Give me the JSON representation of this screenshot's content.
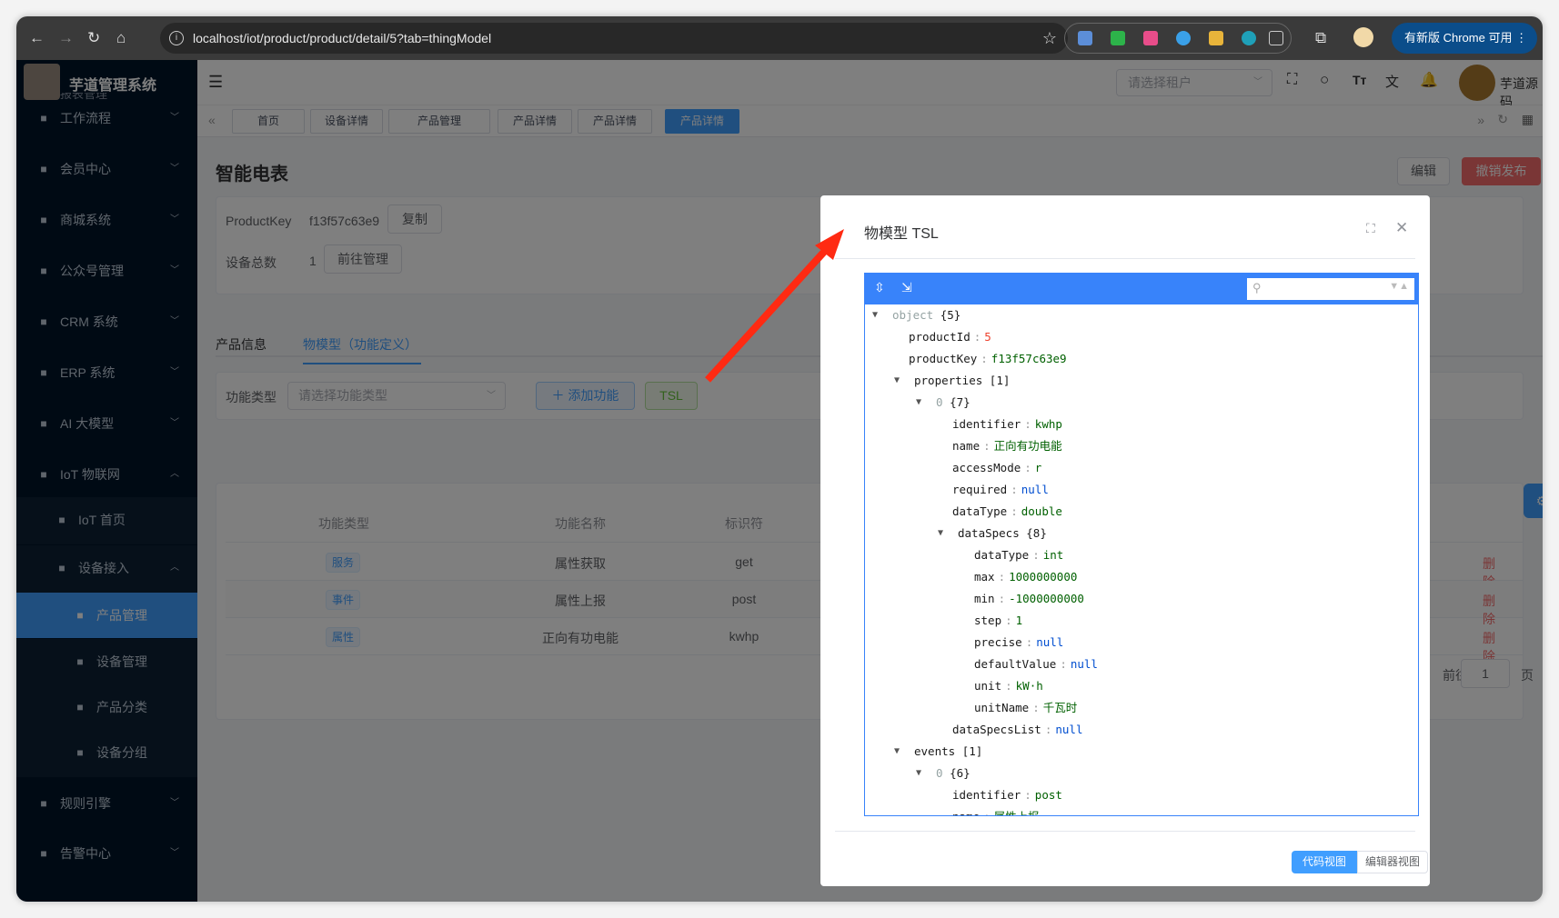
{
  "browser": {
    "url": "localhost/iot/product/product/detail/5?tab=thingModel",
    "update_label": "有新版 Chrome 可用"
  },
  "app": {
    "title": "芋道管理系统",
    "tenant_placeholder": "请选择租户",
    "username": "芋道源码"
  },
  "sidebar": {
    "partial_label": "报表管理",
    "items": [
      {
        "label": "工作流程",
        "icon": "workflow-icon",
        "chev": "﹀",
        "level": 0
      },
      {
        "label": "会员中心",
        "icon": "member-icon",
        "chev": "﹀",
        "level": 0
      },
      {
        "label": "商城系统",
        "icon": "mall-icon",
        "chev": "﹀",
        "level": 0
      },
      {
        "label": "公众号管理",
        "icon": "compass-icon",
        "chev": "﹀",
        "level": 0
      },
      {
        "label": "CRM 系统",
        "icon": "crm-icon",
        "chev": "﹀",
        "level": 0
      },
      {
        "label": "ERP 系统",
        "icon": "erp-icon",
        "chev": "﹀",
        "level": 0
      },
      {
        "label": "AI 大模型",
        "icon": "ai-icon",
        "chev": "﹀",
        "level": 0
      },
      {
        "label": "IoT 物联网",
        "icon": "iot-icon",
        "chev": "︿",
        "level": 0
      },
      {
        "label": "IoT 首页",
        "icon": "home-icon",
        "chev": "",
        "level": 1
      },
      {
        "label": "设备接入",
        "icon": "monitor-icon",
        "chev": "︿",
        "level": 1
      },
      {
        "label": "产品管理",
        "icon": "tools-icon",
        "chev": "",
        "level": 2,
        "active": true
      },
      {
        "label": "设备管理",
        "icon": "device-icon",
        "chev": "",
        "level": 2
      },
      {
        "label": "产品分类",
        "icon": "category-icon",
        "chev": "",
        "level": 2
      },
      {
        "label": "设备分组",
        "icon": "layers-icon",
        "chev": "",
        "level": 2
      },
      {
        "label": "规则引擎",
        "icon": "gears-icon",
        "chev": "﹀",
        "level": 0
      },
      {
        "label": "告警中心",
        "icon": "cloud-icon",
        "chev": "﹀",
        "level": 0
      }
    ]
  },
  "tabs": [
    {
      "label": "首页"
    },
    {
      "label": "设备详情"
    },
    {
      "label": "产品管理"
    },
    {
      "label": "产品详情"
    },
    {
      "label": "产品详情"
    },
    {
      "label": "产品详情",
      "active": true
    }
  ],
  "page": {
    "title": "智能电表",
    "edit_label": "编辑",
    "revoke_label": "撤销发布",
    "product_key_label": "ProductKey",
    "product_key": "f13f57c63e9",
    "copy_label": "复制",
    "device_total_label": "设备总数",
    "device_total": "1",
    "manage_label": "前往管理",
    "tab_info": "产品信息",
    "tab_model": "物模型（功能定义）",
    "filter_label": "功能类型",
    "filter_placeholder": "请选择功能类型",
    "add_label": "添加功能",
    "tsl_label": "TSL",
    "table": {
      "headers": [
        "功能类型",
        "功能名称",
        "标识符"
      ],
      "rows": [
        {
          "type": "服务",
          "name": "属性获取",
          "identifier": "get",
          "action": "删除"
        },
        {
          "type": "事件",
          "name": "属性上报",
          "identifier": "post",
          "action": "删除"
        },
        {
          "type": "属性",
          "name": "正向有功电能",
          "identifier": "kwhp",
          "action": "删除"
        }
      ]
    },
    "pagination": {
      "prefix": "前往",
      "page": "1",
      "suffix": "页"
    }
  },
  "dialog": {
    "title": "物模型 TSL",
    "code_view": "代码视图",
    "editor_view": "编辑器视图",
    "tree": [
      {
        "lvl": 0,
        "toggle": true,
        "key": "object",
        "meta": "{5}"
      },
      {
        "lvl": 1,
        "key": "productId",
        "value": "5",
        "vt": "number"
      },
      {
        "lvl": 1,
        "key": "productKey",
        "value": "f13f57c63e9",
        "vt": "string"
      },
      {
        "lvl": 1,
        "toggle": true,
        "key": "properties",
        "meta": "[1]"
      },
      {
        "lvl": 2,
        "toggle": true,
        "idx": "0",
        "meta": "{7}"
      },
      {
        "lvl": 3,
        "key": "identifier",
        "value": "kwhp",
        "vt": "string"
      },
      {
        "lvl": 3,
        "key": "name",
        "value": "正向有功电能",
        "vt": "string"
      },
      {
        "lvl": 3,
        "key": "accessMode",
        "value": "r",
        "vt": "string"
      },
      {
        "lvl": 3,
        "key": "required",
        "value": "null",
        "vt": "null"
      },
      {
        "lvl": 3,
        "key": "dataType",
        "value": "double",
        "vt": "string"
      },
      {
        "lvl": 3,
        "toggle": true,
        "key": "dataSpecs",
        "meta": "{8}"
      },
      {
        "lvl": 4,
        "key": "dataType",
        "value": "int",
        "vt": "string"
      },
      {
        "lvl": 4,
        "key": "max",
        "value": "1000000000",
        "vt": "string"
      },
      {
        "lvl": 4,
        "key": "min",
        "value": "-1000000000",
        "vt": "string"
      },
      {
        "lvl": 4,
        "key": "step",
        "value": "1",
        "vt": "string"
      },
      {
        "lvl": 4,
        "key": "precise",
        "value": "null",
        "vt": "null"
      },
      {
        "lvl": 4,
        "key": "defaultValue",
        "value": "null",
        "vt": "null"
      },
      {
        "lvl": 4,
        "key": "unit",
        "value": "kW·h",
        "vt": "string"
      },
      {
        "lvl": 4,
        "key": "unitName",
        "value": "千瓦时",
        "vt": "string"
      },
      {
        "lvl": 3,
        "key": "dataSpecsList",
        "value": "null",
        "vt": "null"
      },
      {
        "lvl": 1,
        "toggle": true,
        "key": "events",
        "meta": "[1]"
      },
      {
        "lvl": 2,
        "toggle": true,
        "idx": "0",
        "meta": "{6}"
      },
      {
        "lvl": 3,
        "key": "identifier",
        "value": "post",
        "vt": "string"
      },
      {
        "lvl": 3,
        "key": "name",
        "value": "属性上报",
        "vt": "string"
      }
    ]
  },
  "colors": {
    "primary": "#409eff",
    "danger": "#f56c6c",
    "annotation": "#ff2a12",
    "editor_header": "#3883fa"
  }
}
